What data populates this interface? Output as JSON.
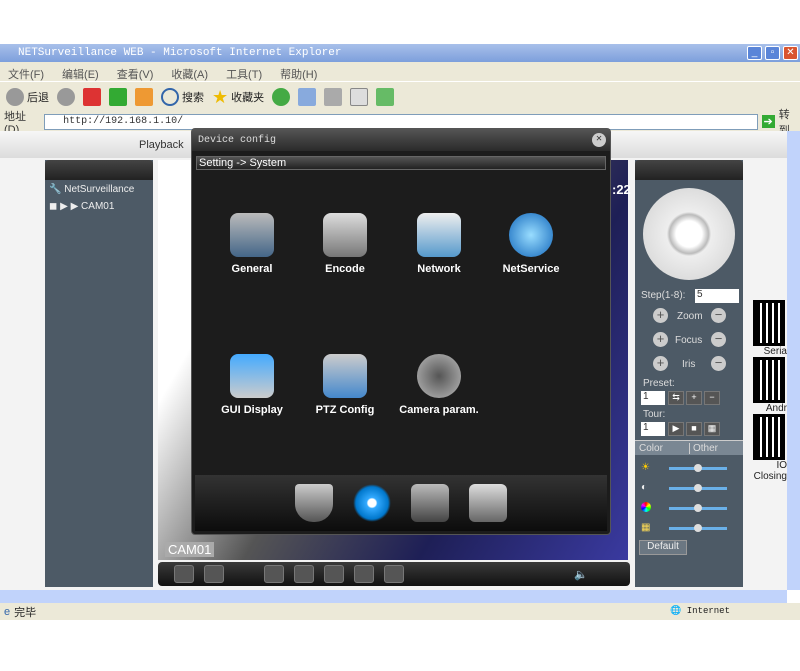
{
  "window": {
    "title": "NETSurveillance WEB - Microsoft Internet Explorer"
  },
  "menu": [
    "文件(F)",
    "编辑(E)",
    "查看(V)",
    "收藏(A)",
    "工具(T)",
    "帮助(H)"
  ],
  "toolbar": {
    "back": "后退",
    "search": "搜索",
    "favorites": "收藏夹"
  },
  "address": {
    "label": "地址(D)",
    "url": "http://192.168.1.10/",
    "go": "转到"
  },
  "nav": {
    "playback": "Playback"
  },
  "tree": {
    "root": "NetSurveillance",
    "camera": "CAM01"
  },
  "video": {
    "camera_label": "CAM01",
    "time_fragment": ":22"
  },
  "dialog": {
    "title": "Device config",
    "breadcrumb": "Setting -> System",
    "items": [
      {
        "label": "General",
        "icon": "wrench-gear-icon"
      },
      {
        "label": "Encode",
        "icon": "gears-icon"
      },
      {
        "label": "Network",
        "icon": "network-icon"
      },
      {
        "label": "NetService",
        "icon": "globe-icon"
      },
      {
        "label": "GUI Display",
        "icon": "display-icon"
      },
      {
        "label": "PTZ Config",
        "icon": "ptz-camera-icon"
      },
      {
        "label": "Camera param.",
        "icon": "webcam-icon"
      }
    ],
    "bottom_tabs": [
      "alarm-shield-icon",
      "system-gear-icon",
      "management-tools-icon",
      "info-checklist-icon"
    ]
  },
  "ptz": {
    "step_label": "Step(1-8):",
    "step_value": "5",
    "zoom": "Zoom",
    "focus": "Focus",
    "iris": "Iris",
    "preset_label": "Preset:",
    "preset_value": "1",
    "tour_label": "Tour:",
    "tour_value": "1",
    "tab_color": "Color",
    "tab_other": "Other",
    "default": "Default",
    "sliders": [
      50,
      50,
      50,
      50
    ]
  },
  "qr": [
    "Seria",
    "Andr",
    "IO",
    "Closing"
  ],
  "status": {
    "text": "完毕",
    "zone": "Internet"
  }
}
